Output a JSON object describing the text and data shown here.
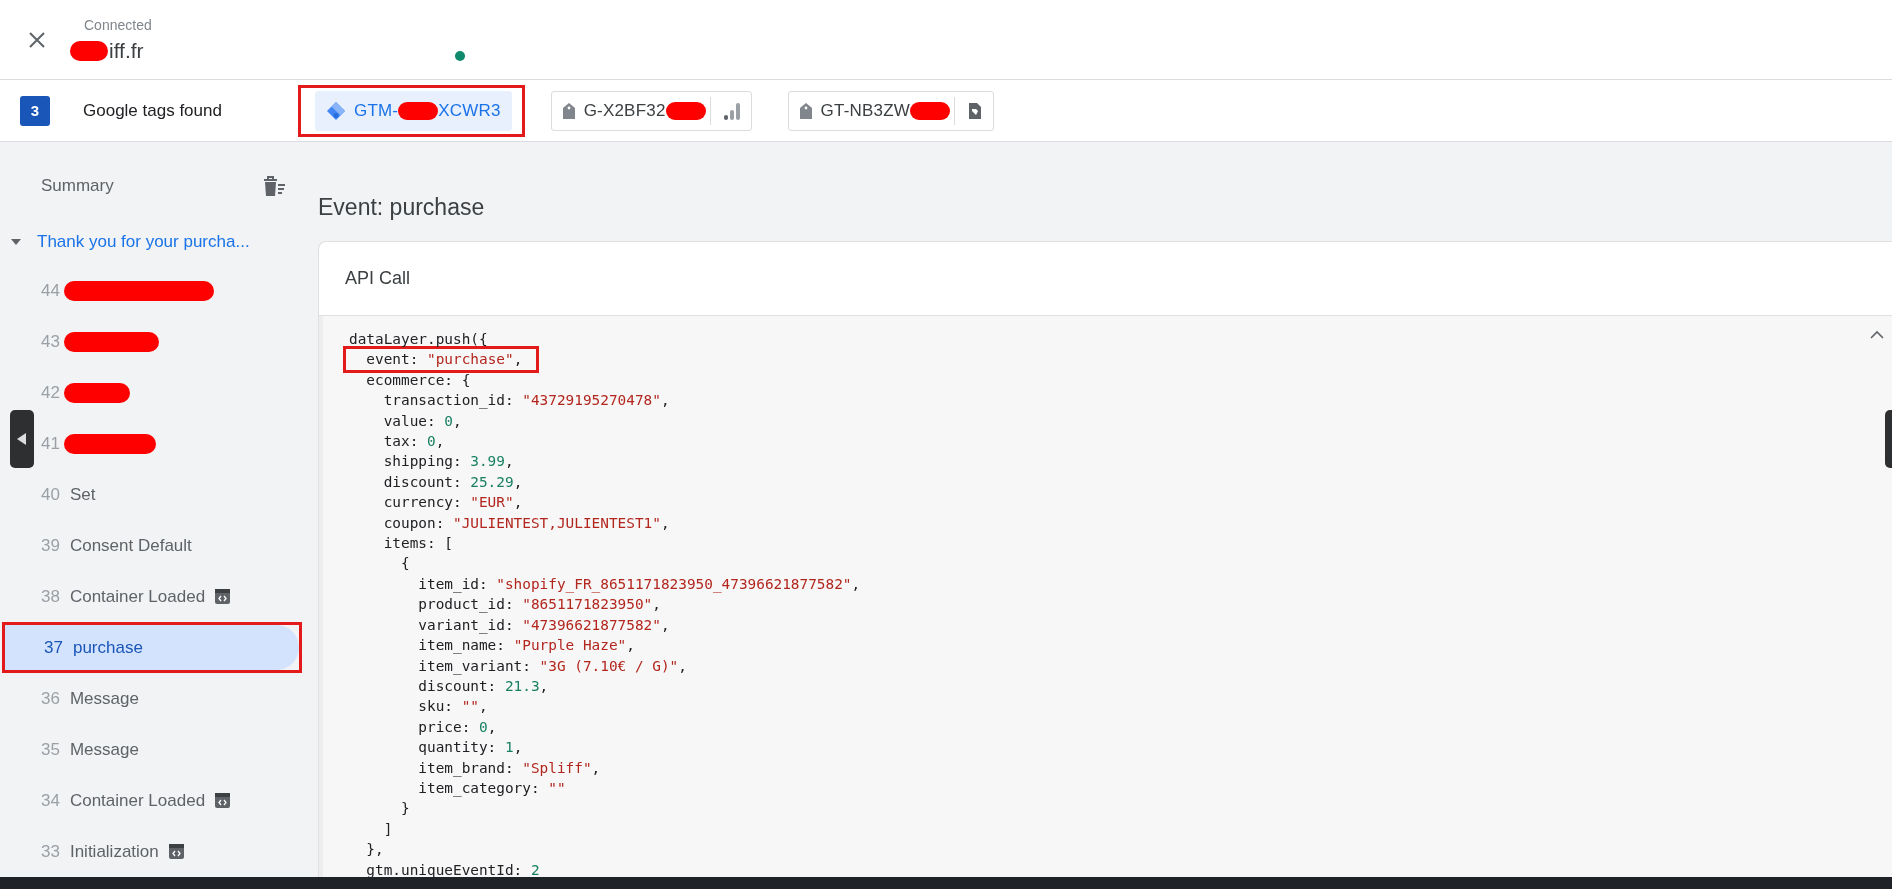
{
  "header": {
    "status": "Connected",
    "domain": "iff.fr",
    "domain_redacted": true
  },
  "tags": {
    "count": "3",
    "label": "Google tags found",
    "items": [
      {
        "kind": "gtm",
        "prefix": "GTM-",
        "suffix": "XCWR3",
        "redacted": true,
        "selected": true,
        "annotated": true
      },
      {
        "kind": "ga",
        "prefix": "G-X2BF32",
        "redacted": true,
        "selected": false,
        "annotated": false
      },
      {
        "kind": "gt",
        "prefix": "GT-NB3ZW",
        "redacted": true,
        "selected": false,
        "annotated": false
      }
    ]
  },
  "sidebar": {
    "summary": "Summary",
    "page": {
      "title": "Thank you for your purcha...",
      "expanded": true
    },
    "events": [
      {
        "number": "44",
        "redacted": true,
        "selected": false,
        "annotated": false,
        "has_icon": false
      },
      {
        "number": "43",
        "redacted": true,
        "selected": false,
        "annotated": false,
        "has_icon": false
      },
      {
        "number": "42",
        "redacted": true,
        "selected": false,
        "annotated": false,
        "has_icon": false
      },
      {
        "number": "41",
        "redacted": true,
        "selected": false,
        "annotated": false,
        "has_icon": false
      },
      {
        "number": "40",
        "label": "Set",
        "redacted": false,
        "selected": false,
        "annotated": false,
        "has_icon": false
      },
      {
        "number": "39",
        "label": "Consent Default",
        "redacted": false,
        "selected": false,
        "annotated": false,
        "has_icon": false
      },
      {
        "number": "38",
        "label": "Container Loaded",
        "redacted": false,
        "selected": false,
        "annotated": false,
        "has_icon": true
      },
      {
        "number": "37",
        "label": "purchase",
        "redacted": false,
        "selected": true,
        "annotated": true,
        "has_icon": false
      },
      {
        "number": "36",
        "label": "Message",
        "redacted": false,
        "selected": false,
        "annotated": false,
        "has_icon": false
      },
      {
        "number": "35",
        "label": "Message",
        "redacted": false,
        "selected": false,
        "annotated": false,
        "has_icon": false
      },
      {
        "number": "34",
        "label": "Container Loaded",
        "redacted": false,
        "selected": false,
        "annotated": false,
        "has_icon": true
      },
      {
        "number": "33",
        "label": "Initialization",
        "redacted": false,
        "selected": false,
        "annotated": false,
        "has_icon": true
      }
    ]
  },
  "main": {
    "title": "Event: purchase",
    "card": {
      "title": "API Call",
      "expanded": true,
      "lines": [
        {
          "annotated": false,
          "parts": [
            {
              "kind": "plain",
              "text": "dataLayer.push({"
            }
          ]
        },
        {
          "annotated": true,
          "parts": [
            {
              "kind": "plain",
              "text": "  event: "
            },
            {
              "kind": "string",
              "text": "\"purchase\""
            },
            {
              "kind": "plain",
              "text": ","
            }
          ]
        },
        {
          "annotated": false,
          "parts": [
            {
              "kind": "plain",
              "text": "  ecommerce: {"
            }
          ]
        },
        {
          "annotated": false,
          "parts": [
            {
              "kind": "plain",
              "text": "    transaction_id: "
            },
            {
              "kind": "string",
              "text": "\"43729195270478\""
            },
            {
              "kind": "plain",
              "text": ","
            }
          ]
        },
        {
          "annotated": false,
          "parts": [
            {
              "kind": "plain",
              "text": "    value: "
            },
            {
              "kind": "number",
              "text": "0"
            },
            {
              "kind": "plain",
              "text": ","
            }
          ]
        },
        {
          "annotated": false,
          "parts": [
            {
              "kind": "plain",
              "text": "    tax: "
            },
            {
              "kind": "number",
              "text": "0"
            },
            {
              "kind": "plain",
              "text": ","
            }
          ]
        },
        {
          "annotated": false,
          "parts": [
            {
              "kind": "plain",
              "text": "    shipping: "
            },
            {
              "kind": "number",
              "text": "3.99"
            },
            {
              "kind": "plain",
              "text": ","
            }
          ]
        },
        {
          "annotated": false,
          "parts": [
            {
              "kind": "plain",
              "text": "    discount: "
            },
            {
              "kind": "number",
              "text": "25.29"
            },
            {
              "kind": "plain",
              "text": ","
            }
          ]
        },
        {
          "annotated": false,
          "parts": [
            {
              "kind": "plain",
              "text": "    currency: "
            },
            {
              "kind": "string",
              "text": "\"EUR\""
            },
            {
              "kind": "plain",
              "text": ","
            }
          ]
        },
        {
          "annotated": false,
          "parts": [
            {
              "kind": "plain",
              "text": "    coupon: "
            },
            {
              "kind": "string",
              "text": "\"JULIENTEST,JULIENTEST1\""
            },
            {
              "kind": "plain",
              "text": ","
            }
          ]
        },
        {
          "annotated": false,
          "parts": [
            {
              "kind": "plain",
              "text": "    items: ["
            }
          ]
        },
        {
          "annotated": false,
          "parts": [
            {
              "kind": "plain",
              "text": "      {"
            }
          ]
        },
        {
          "annotated": false,
          "parts": [
            {
              "kind": "plain",
              "text": "        item_id: "
            },
            {
              "kind": "string",
              "text": "\"shopify_FR_8651171823950_47396621877582\""
            },
            {
              "kind": "plain",
              "text": ","
            }
          ]
        },
        {
          "annotated": false,
          "parts": [
            {
              "kind": "plain",
              "text": "        product_id: "
            },
            {
              "kind": "string",
              "text": "\"8651171823950\""
            },
            {
              "kind": "plain",
              "text": ","
            }
          ]
        },
        {
          "annotated": false,
          "parts": [
            {
              "kind": "plain",
              "text": "        variant_id: "
            },
            {
              "kind": "string",
              "text": "\"47396621877582\""
            },
            {
              "kind": "plain",
              "text": ","
            }
          ]
        },
        {
          "annotated": false,
          "parts": [
            {
              "kind": "plain",
              "text": "        item_name: "
            },
            {
              "kind": "string",
              "text": "\"Purple Haze\""
            },
            {
              "kind": "plain",
              "text": ","
            }
          ]
        },
        {
          "annotated": false,
          "parts": [
            {
              "kind": "plain",
              "text": "        item_variant: "
            },
            {
              "kind": "string",
              "text": "\"3G (7.10€ / G)\""
            },
            {
              "kind": "plain",
              "text": ","
            }
          ]
        },
        {
          "annotated": false,
          "parts": [
            {
              "kind": "plain",
              "text": "        discount: "
            },
            {
              "kind": "number",
              "text": "21.3"
            },
            {
              "kind": "plain",
              "text": ","
            }
          ]
        },
        {
          "annotated": false,
          "parts": [
            {
              "kind": "plain",
              "text": "        sku: "
            },
            {
              "kind": "string",
              "text": "\"\""
            },
            {
              "kind": "plain",
              "text": ","
            }
          ]
        },
        {
          "annotated": false,
          "parts": [
            {
              "kind": "plain",
              "text": "        price: "
            },
            {
              "kind": "number",
              "text": "0"
            },
            {
              "kind": "plain",
              "text": ","
            }
          ]
        },
        {
          "annotated": false,
          "parts": [
            {
              "kind": "plain",
              "text": "        quantity: "
            },
            {
              "kind": "number",
              "text": "1"
            },
            {
              "kind": "plain",
              "text": ","
            }
          ]
        },
        {
          "annotated": false,
          "parts": [
            {
              "kind": "plain",
              "text": "        item_brand: "
            },
            {
              "kind": "string",
              "text": "\"Spliff\""
            },
            {
              "kind": "plain",
              "text": ","
            }
          ]
        },
        {
          "annotated": false,
          "parts": [
            {
              "kind": "plain",
              "text": "        item_category: "
            },
            {
              "kind": "string",
              "text": "\"\""
            }
          ]
        },
        {
          "annotated": false,
          "parts": [
            {
              "kind": "plain",
              "text": "      }"
            }
          ]
        },
        {
          "annotated": false,
          "parts": [
            {
              "kind": "plain",
              "text": "    ]"
            }
          ]
        },
        {
          "annotated": false,
          "parts": [
            {
              "kind": "plain",
              "text": "  },"
            }
          ]
        },
        {
          "annotated": false,
          "parts": [
            {
              "kind": "plain",
              "text": "  gtm.uniqueEventId: "
            },
            {
              "kind": "number",
              "text": "2"
            }
          ]
        }
      ]
    }
  }
}
